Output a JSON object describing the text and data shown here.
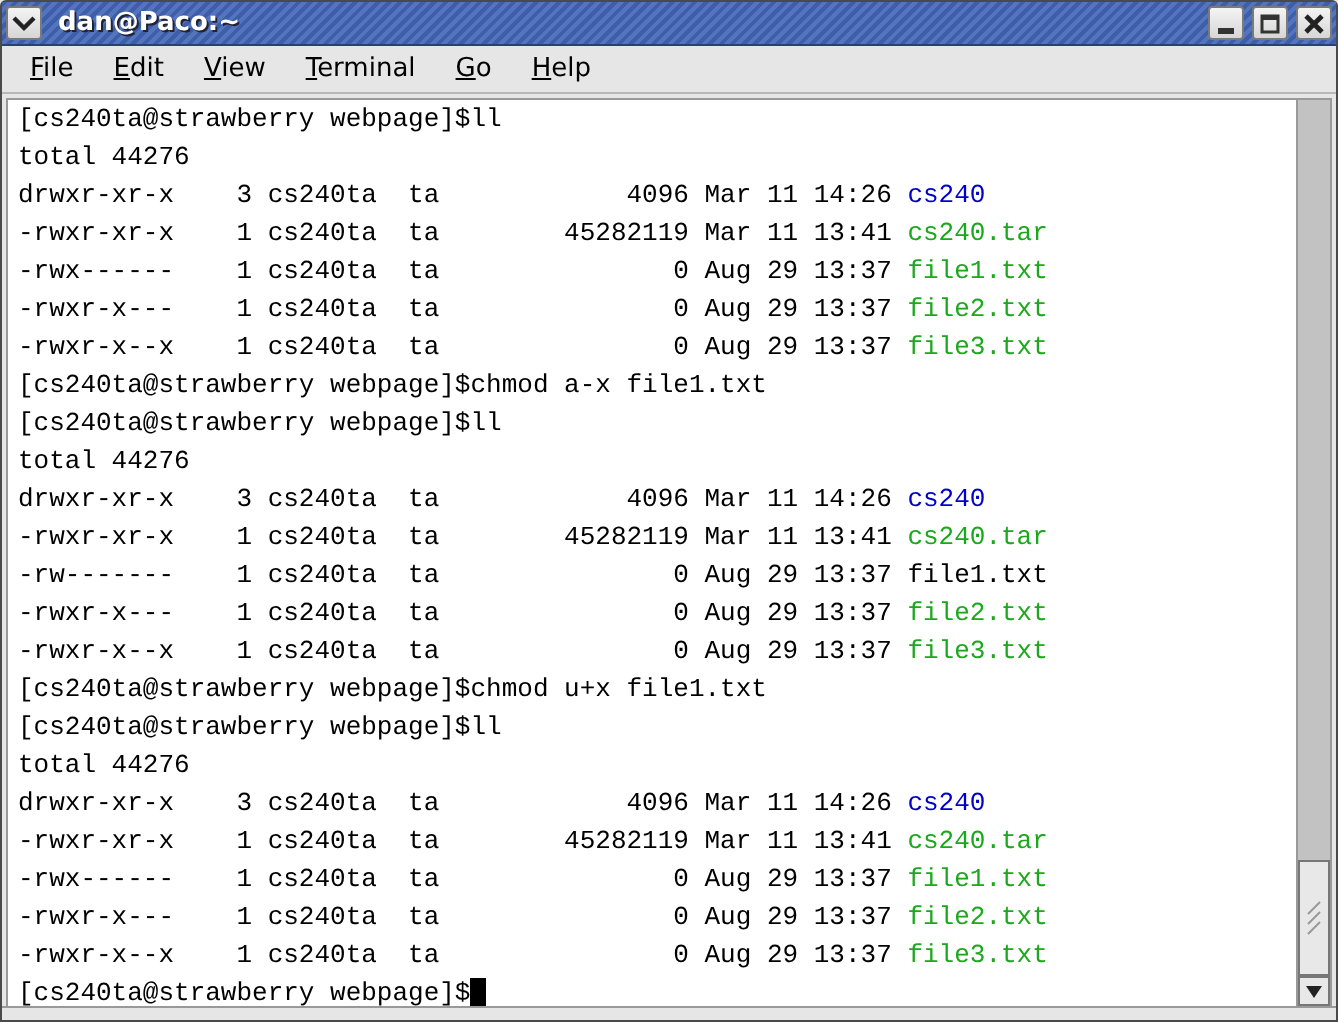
{
  "window": {
    "title": "dan@Paco:~"
  },
  "menu": [
    "File",
    "Edit",
    "View",
    "Terminal",
    "Go",
    "Help"
  ],
  "terminal": {
    "lines": [
      {
        "kind": "prompt",
        "prompt": "[cs240ta@strawberry webpage]$",
        "command": "ll"
      },
      {
        "kind": "output",
        "text": "total 44276"
      },
      {
        "kind": "entry",
        "perms": "drwxr-xr-x",
        "links": "3",
        "owner": "cs240ta",
        "group": "ta",
        "size": "4096",
        "date": "Mar 11",
        "time": "14:26",
        "name": "cs240",
        "color": "#0000c8"
      },
      {
        "kind": "entry",
        "perms": "-rwxr-xr-x",
        "links": "1",
        "owner": "cs240ta",
        "group": "ta",
        "size": "45282119",
        "date": "Mar 11",
        "time": "13:41",
        "name": "cs240.tar",
        "color": "#1ca81c"
      },
      {
        "kind": "entry",
        "perms": "-rwx------",
        "links": "1",
        "owner": "cs240ta",
        "group": "ta",
        "size": "0",
        "date": "Aug 29",
        "time": "13:37",
        "name": "file1.txt",
        "color": "#1ca81c"
      },
      {
        "kind": "entry",
        "perms": "-rwxr-x---",
        "links": "1",
        "owner": "cs240ta",
        "group": "ta",
        "size": "0",
        "date": "Aug 29",
        "time": "13:37",
        "name": "file2.txt",
        "color": "#1ca81c"
      },
      {
        "kind": "entry",
        "perms": "-rwxr-x--x",
        "links": "1",
        "owner": "cs240ta",
        "group": "ta",
        "size": "0",
        "date": "Aug 29",
        "time": "13:37",
        "name": "file3.txt",
        "color": "#1ca81c"
      },
      {
        "kind": "prompt",
        "prompt": "[cs240ta@strawberry webpage]$",
        "command": "chmod a-x file1.txt"
      },
      {
        "kind": "prompt",
        "prompt": "[cs240ta@strawberry webpage]$",
        "command": "ll"
      },
      {
        "kind": "output",
        "text": "total 44276"
      },
      {
        "kind": "entry",
        "perms": "drwxr-xr-x",
        "links": "3",
        "owner": "cs240ta",
        "group": "ta",
        "size": "4096",
        "date": "Mar 11",
        "time": "14:26",
        "name": "cs240",
        "color": "#0000c8"
      },
      {
        "kind": "entry",
        "perms": "-rwxr-xr-x",
        "links": "1",
        "owner": "cs240ta",
        "group": "ta",
        "size": "45282119",
        "date": "Mar 11",
        "time": "13:41",
        "name": "cs240.tar",
        "color": "#1ca81c"
      },
      {
        "kind": "entry",
        "perms": "-rw-------",
        "links": "1",
        "owner": "cs240ta",
        "group": "ta",
        "size": "0",
        "date": "Aug 29",
        "time": "13:37",
        "name": "file1.txt",
        "color": "#000000"
      },
      {
        "kind": "entry",
        "perms": "-rwxr-x---",
        "links": "1",
        "owner": "cs240ta",
        "group": "ta",
        "size": "0",
        "date": "Aug 29",
        "time": "13:37",
        "name": "file2.txt",
        "color": "#1ca81c"
      },
      {
        "kind": "entry",
        "perms": "-rwxr-x--x",
        "links": "1",
        "owner": "cs240ta",
        "group": "ta",
        "size": "0",
        "date": "Aug 29",
        "time": "13:37",
        "name": "file3.txt",
        "color": "#1ca81c"
      },
      {
        "kind": "prompt",
        "prompt": "[cs240ta@strawberry webpage]$",
        "command": "chmod u+x file1.txt"
      },
      {
        "kind": "prompt",
        "prompt": "[cs240ta@strawberry webpage]$",
        "command": "ll"
      },
      {
        "kind": "output",
        "text": "total 44276"
      },
      {
        "kind": "entry",
        "perms": "drwxr-xr-x",
        "links": "3",
        "owner": "cs240ta",
        "group": "ta",
        "size": "4096",
        "date": "Mar 11",
        "time": "14:26",
        "name": "cs240",
        "color": "#0000c8"
      },
      {
        "kind": "entry",
        "perms": "-rwxr-xr-x",
        "links": "1",
        "owner": "cs240ta",
        "group": "ta",
        "size": "45282119",
        "date": "Mar 11",
        "time": "13:41",
        "name": "cs240.tar",
        "color": "#1ca81c"
      },
      {
        "kind": "entry",
        "perms": "-rwx------",
        "links": "1",
        "owner": "cs240ta",
        "group": "ta",
        "size": "0",
        "date": "Aug 29",
        "time": "13:37",
        "name": "file1.txt",
        "color": "#1ca81c"
      },
      {
        "kind": "entry",
        "perms": "-rwxr-x---",
        "links": "1",
        "owner": "cs240ta",
        "group": "ta",
        "size": "0",
        "date": "Aug 29",
        "time": "13:37",
        "name": "file2.txt",
        "color": "#1ca81c"
      },
      {
        "kind": "entry",
        "perms": "-rwxr-x--x",
        "links": "1",
        "owner": "cs240ta",
        "group": "ta",
        "size": "0",
        "date": "Aug 29",
        "time": "13:37",
        "name": "file3.txt",
        "color": "#1ca81c"
      },
      {
        "kind": "prompt",
        "prompt": "[cs240ta@strawberry webpage]$",
        "cursor": true
      }
    ]
  }
}
